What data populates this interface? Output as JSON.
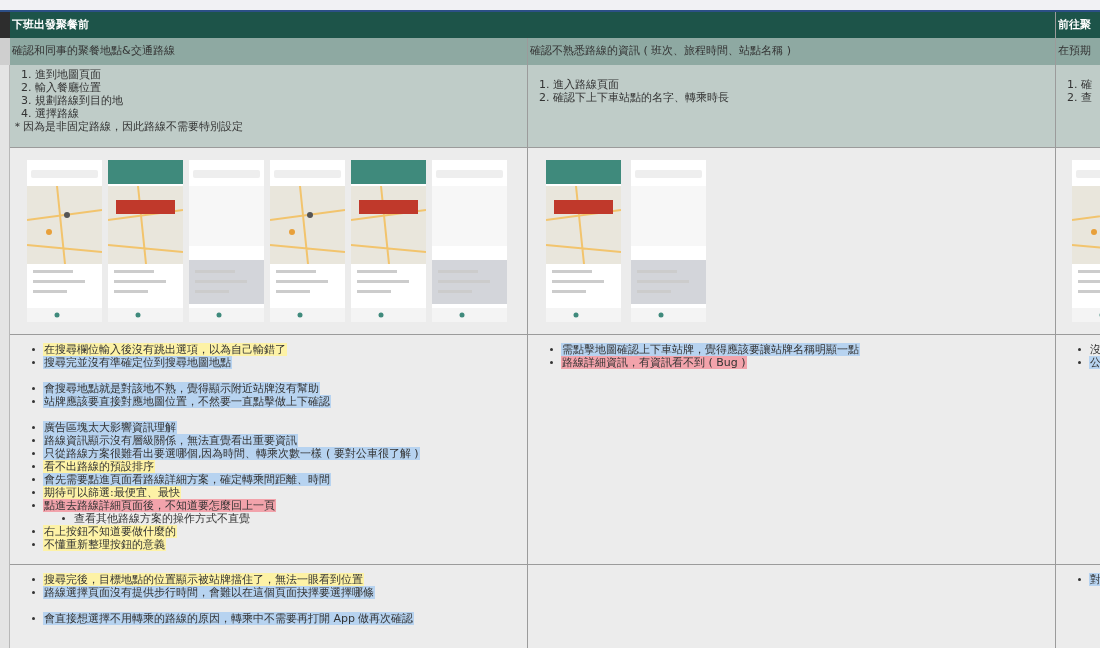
{
  "sections": [
    {
      "title": "下班出發聚餐前",
      "goal": "確認和同事的聚餐地點&交通路線",
      "steps": [
        "1. 進到地圖頁面",
        "2. 輸入餐廳位置",
        "3. 規劃路線到目的地",
        "4. 選擇路線",
        "＊因為是非固定路線，因此路線不需要特別設定"
      ],
      "screenshots": [
        {
          "kind": "picture"
        },
        {
          "kind": "picture"
        },
        {
          "kind": "picture"
        },
        {
          "kind": "picture"
        },
        {
          "kind": "picture"
        },
        {
          "kind": "picture"
        }
      ],
      "pain_points": [
        {
          "items": [
            {
              "text": "在搜尋欄位輸入後沒有跳出選項，以為自己輸錯了",
              "color": "#fdf2a6"
            },
            {
              "text": "搜尋完並沒有準確定位到搜尋地圖地點",
              "color": "#b7d3f0"
            }
          ]
        },
        {
          "items": [
            {
              "text": "會搜尋地點就是對該地不熟，覺得顯示附近站牌沒有幫助",
              "color": "#b7d3f0"
            },
            {
              "text": "站牌應該要直接對應地圖位置，不然要一直點擊做上下確認",
              "color": "#b7d3f0"
            }
          ]
        },
        {
          "items": [
            {
              "text": "廣告區塊太大影響資訊理解",
              "color": "#b7d3f0"
            },
            {
              "text": "路線資訊顯示沒有層級關係，無法直覺看出重要資訊",
              "color": "#b7d3f0"
            },
            {
              "text": "只從路線方案很難看出要選哪個,因為時間、轉乘次數一樣 ( 要對公車很了解 )",
              "color": "#b7d3f0"
            },
            {
              "text": "看不出路線的預設排序",
              "color": "#fdf2a6"
            },
            {
              "text": "會先需要點進頁面看路線詳細方案，確定轉乘間距離、時間",
              "color": "#b7d3f0"
            },
            {
              "text": "期待可以篩選:最便宜、最快",
              "color": "#fdf2a6"
            },
            {
              "text": "點進去路線詳細頁面後，不知道要怎麼回上一頁",
              "color": "#f2a3ab",
              "children": [
                {
                  "text": "查看其他路線方案的操作方式不直覺"
                }
              ]
            },
            {
              "text": "右上按鈕不知道要做什麼的",
              "color": "#fdf2a6"
            },
            {
              "text": "不懂重新整理按鈕的意義",
              "color": "#fdf2a6"
            }
          ]
        }
      ],
      "notes": [
        {
          "items": [
            {
              "text": "搜尋完後，目標地點的位置顯示被站牌擋住了，無法一眼看到位置",
              "color": "#fdf2a6"
            },
            {
              "text": "路線選擇頁面沒有提供步行時間，會難以在這個頁面抉擇要選擇哪條",
              "color": "#b7d3f0"
            }
          ]
        },
        {
          "items": [
            {
              "text": "會直接想選擇不用轉乘的路線的原因，轉乘中不需要再打開 App 做再次確認",
              "color": "#b7d3f0"
            }
          ]
        }
      ]
    },
    {
      "goal": "確認不熟悉路線的資訊 ( 班次、旅程時間、站點名稱 )",
      "steps": [
        "1. 進入路線頁面",
        "2. 確認下上下車站點的名字、轉乘時長"
      ],
      "screenshots": [
        {
          "kind": "picture"
        },
        {
          "kind": "picture"
        }
      ],
      "pain_points": [
        {
          "items": [
            {
              "text": "需點擊地圖確認上下車站牌，覺得應該要讓站牌名稱明顯一點",
              "color": "#b7d3f0"
            },
            {
              "text": "路線詳細資訊，有資訊看不到 ( Bug )",
              "color": "#f2a3ab"
            }
          ]
        }
      ]
    },
    {
      "title": "前往聚",
      "goal": "在預期",
      "steps": [
        "1. 確",
        "2. 查"
      ],
      "screenshots": [
        {
          "kind": "picture"
        }
      ],
      "pain_points": [
        {
          "items": [
            {
              "text": "沒"
            },
            {
              "text": "公",
              "color": "#b7d3f0"
            }
          ]
        }
      ],
      "notes": [
        {
          "items": [
            {
              "text": "對",
              "color": "#b7d3f0"
            }
          ]
        }
      ]
    }
  ]
}
